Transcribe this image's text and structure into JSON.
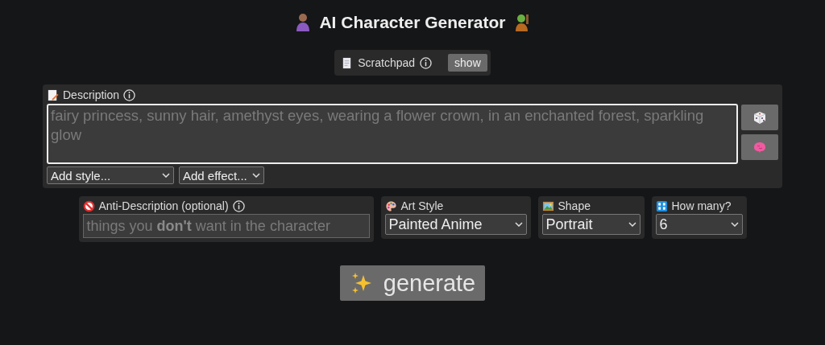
{
  "title": "AI Character Generator",
  "scratchpad": {
    "label": "Scratchpad",
    "button": "show"
  },
  "description": {
    "label": "Description",
    "placeholder": "fairy princess, sunny hair, amethyst eyes, wearing a flower crown, in an enchanted forest, sparkling glow",
    "style_select": {
      "value": "Add style..."
    },
    "effect_select": {
      "value": "Add effect..."
    }
  },
  "anti_description": {
    "label": "Anti-Description (optional)",
    "placeholder": "things you **don't** want in the character"
  },
  "options": [
    {
      "kind": "palette",
      "label": "Art Style",
      "value": "Painted Anime"
    },
    {
      "kind": "picture",
      "label": "Shape",
      "value": "Portrait"
    },
    {
      "kind": "numbers",
      "label": "How many?",
      "value": "6"
    }
  ],
  "generate_button": "generate"
}
